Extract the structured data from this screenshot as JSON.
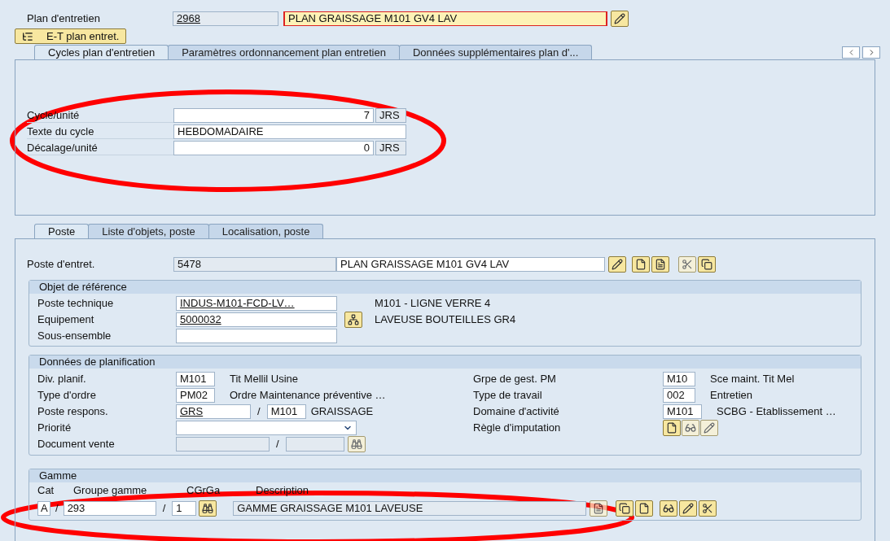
{
  "header": {
    "label": "Plan d'entretien",
    "number": "2968",
    "description": "PLAN GRAISSAGE M101 GV4 LAV"
  },
  "structure_button": "E-T plan entret.",
  "top_tabs": [
    {
      "label": "Cycles plan d'entretien",
      "selected": true
    },
    {
      "label": "Paramètres ordonnancement plan entretien",
      "selected": false
    },
    {
      "label": "Données supplémentaires plan d'...",
      "selected": false
    }
  ],
  "cycle_fields": [
    {
      "label": "Cycle/unité",
      "value": "7",
      "unit": "JRS",
      "kind": "number"
    },
    {
      "label": "Texte du cycle",
      "value": "HEBDOMADAIRE",
      "kind": "text"
    },
    {
      "label": "Décalage/unité",
      "value": "0",
      "unit": "JRS",
      "kind": "number"
    }
  ],
  "item_tabs": [
    {
      "label": "Poste",
      "selected": true
    },
    {
      "label": "Liste d'objets, poste",
      "selected": false
    },
    {
      "label": "Localisation, poste",
      "selected": false
    }
  ],
  "item": {
    "label": "Poste d'entret.",
    "number": "5478",
    "description": "PLAN GRAISSAGE M101 GV4 LAV"
  },
  "reference_object": {
    "title": "Objet de référence",
    "rows": [
      {
        "label": "Poste technique",
        "value": "INDUS-M101-FCD-LV…",
        "text": "M101 - LIGNE VERRE 4",
        "kind": "plain"
      },
      {
        "label": "Equipement",
        "value": "5000032",
        "text": "LAVEUSE BOUTEILLES GR4",
        "kind": "lookup"
      },
      {
        "label": "Sous-ensemble",
        "kind": "plain"
      }
    ]
  },
  "planning": {
    "title": "Données de planification",
    "left": [
      {
        "label": "Div. planif.",
        "kind": "code",
        "code": "M101",
        "text": "Tit Mellil Usine"
      },
      {
        "label": "Type d'ordre",
        "kind": "code",
        "code": "PM02",
        "text": "Ordre Maintenance préventive …"
      },
      {
        "label": "Poste respons.",
        "kind": "pair",
        "separator": "/",
        "value": "GRS",
        "code": "M101",
        "text": "GRAISSAGE"
      },
      {
        "label": "Priorité",
        "kind": "dropdown"
      },
      {
        "label": "Document vente",
        "kind": "pair_disabled",
        "separator": "/"
      }
    ],
    "right": [
      {
        "label": "Grpe de gest. PM",
        "kind": "code",
        "code": "M10",
        "text": "Sce maint. Tit Mel"
      },
      {
        "label": "Type de travail",
        "kind": "code",
        "code": "002",
        "text": "Entretien"
      },
      {
        "label": "Domaine d'activité",
        "kind": "code",
        "code": "M101",
        "text": "SCBG - Etablissement …"
      },
      {
        "label": "Règle d'imputation",
        "kind": "buttons"
      }
    ]
  },
  "task_list": {
    "title": "Gamme",
    "columns": [
      "Cat",
      "Groupe gamme",
      "CGrGa",
      "Description"
    ],
    "type": "A",
    "separators": [
      "/",
      "/"
    ],
    "group": "293",
    "counter": "1",
    "description": "GAMME GRAISSAGE M101 LAVEUSE"
  }
}
